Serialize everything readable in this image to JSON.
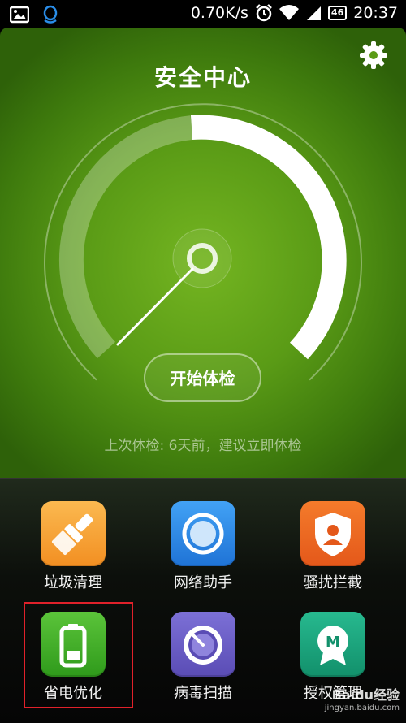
{
  "status_bar": {
    "network_speed": "0.70K/s",
    "battery_level": "46",
    "time": "20:37",
    "icons": [
      "image-icon",
      "qq-icon",
      "alarm-icon",
      "wifi-icon",
      "signal-icon",
      "battery-icon"
    ]
  },
  "header": {
    "title": "安全中心",
    "settings_icon": "gear-icon"
  },
  "gauge": {
    "check_button_label": "开始体检",
    "last_check_text": "上次体检: 6天前，建议立即体检",
    "colors": {
      "track": "#ffffff",
      "background_top": "#74b521",
      "background_edge": "#2e6109"
    }
  },
  "tools": [
    {
      "label": "垃圾清理",
      "icon": "broom-icon",
      "color": "#f7a33a"
    },
    {
      "label": "网络助手",
      "icon": "network-icon",
      "color": "#2f8fe8"
    },
    {
      "label": "骚扰拦截",
      "icon": "shield-user-icon",
      "color": "#ef6a1f"
    },
    {
      "label": "省电优化",
      "icon": "battery-icon",
      "color": "#46b42a"
    },
    {
      "label": "病毒扫描",
      "icon": "virus-scan-icon",
      "color": "#6d5fc8"
    },
    {
      "label": "授权管理",
      "icon": "permission-icon",
      "color": "#1aa57f"
    }
  ],
  "watermark": {
    "brand": "Baidu经验",
    "url": "jingyan.baidu.com"
  }
}
